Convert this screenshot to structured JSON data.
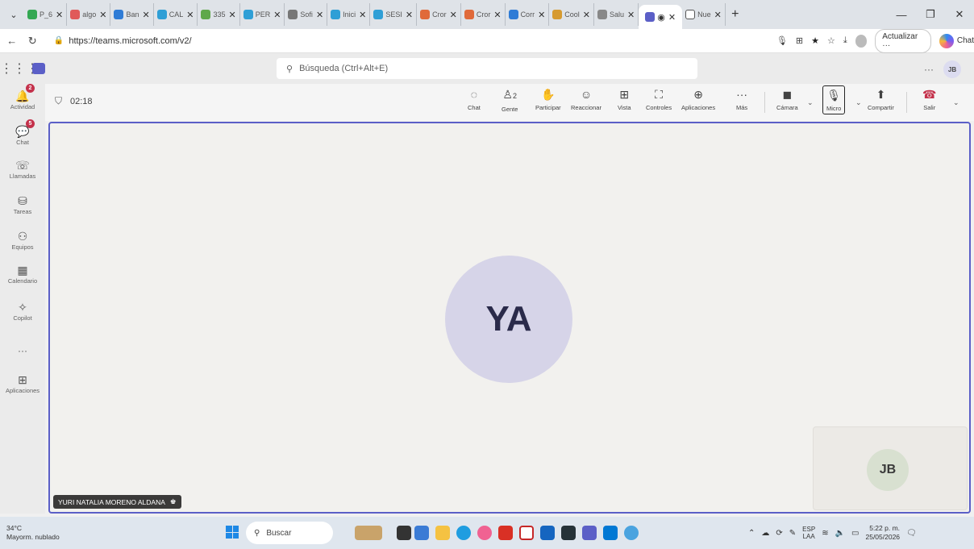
{
  "browser": {
    "tabs": [
      {
        "label": "P_6",
        "color": "#34a853"
      },
      {
        "label": "algo",
        "color": "#e05a5a"
      },
      {
        "label": "Ban",
        "color": "#2f7cd6"
      },
      {
        "label": "CAL",
        "color": "#2f9fd6"
      },
      {
        "label": "335",
        "color": "#5fa84a"
      },
      {
        "label": "PER",
        "color": "#2f9fd6"
      },
      {
        "label": "Sofi",
        "color": "#777777"
      },
      {
        "label": "Inici",
        "color": "#2f9fd6"
      },
      {
        "label": "SESI",
        "color": "#2f9fd6"
      },
      {
        "label": "Cror",
        "color": "#e06a3a"
      },
      {
        "label": "Cror",
        "color": "#e06a3a"
      },
      {
        "label": "Corr",
        "color": "#2f7cd6"
      },
      {
        "label": "Cool",
        "color": "#d69a2f"
      },
      {
        "label": "Salu",
        "color": "#888888"
      }
    ],
    "active_tab_icon": "teams-icon",
    "extra_tab": {
      "label": "Nue"
    },
    "url": "https://teams.microsoft.com/v2/",
    "update_label": "Actualizar",
    "more_label": "···",
    "chat_label": "Chat"
  },
  "teams": {
    "search_placeholder": "Búsqueda (Ctrl+Alt+E)",
    "more_label": "···",
    "user_initials": "JB",
    "rail": [
      {
        "label": "Actividad",
        "icon": "bell-icon",
        "glyph": "🔔",
        "badge": "2"
      },
      {
        "label": "Chat",
        "icon": "chat-icon",
        "glyph": "💬",
        "badge": "5"
      },
      {
        "label": "Llamadas",
        "icon": "phone-icon",
        "glyph": "☏",
        "badge": ""
      },
      {
        "label": "Tareas",
        "icon": "tasks-icon",
        "glyph": "⛁",
        "badge": ""
      },
      {
        "label": "Equipos",
        "icon": "teams-group-icon",
        "glyph": "⚇",
        "badge": ""
      },
      {
        "label": "Calendario",
        "icon": "calendar-icon",
        "glyph": "▦",
        "badge": ""
      },
      {
        "label": "Copilot",
        "icon": "copilot-icon",
        "glyph": "✧",
        "badge": ""
      },
      {
        "label": "···",
        "icon": "more-icon",
        "glyph": "",
        "badge": ""
      },
      {
        "label": "Aplicaciones",
        "icon": "apps-icon",
        "glyph": "⊞",
        "badge": ""
      }
    ]
  },
  "meeting": {
    "timer": "02:18",
    "people_count": "2",
    "tools": {
      "chat": "Chat",
      "people": "Gente",
      "raise": "Participar",
      "react": "Reaccionar",
      "view": "Vista",
      "controls": "Controles",
      "apps": "Aplicaciones",
      "more": "Más",
      "camera": "Cámara",
      "mic": "Micro",
      "share": "Compartir",
      "leave": "Salir"
    },
    "participant_initials": "YA",
    "participant_name": "YURI NATALIA MORENO ALDANA",
    "self_initials": "JB",
    "leave_color": "#c4314b",
    "accent": "#5b5fc7"
  },
  "taskbar": {
    "temperature": "34°C",
    "weather": "Mayorm. nublado",
    "search_label": "Buscar",
    "lang_top": "ESP",
    "lang_bottom": "LAA",
    "time": "5:22 p. m.",
    "date": "25/05/2026"
  }
}
